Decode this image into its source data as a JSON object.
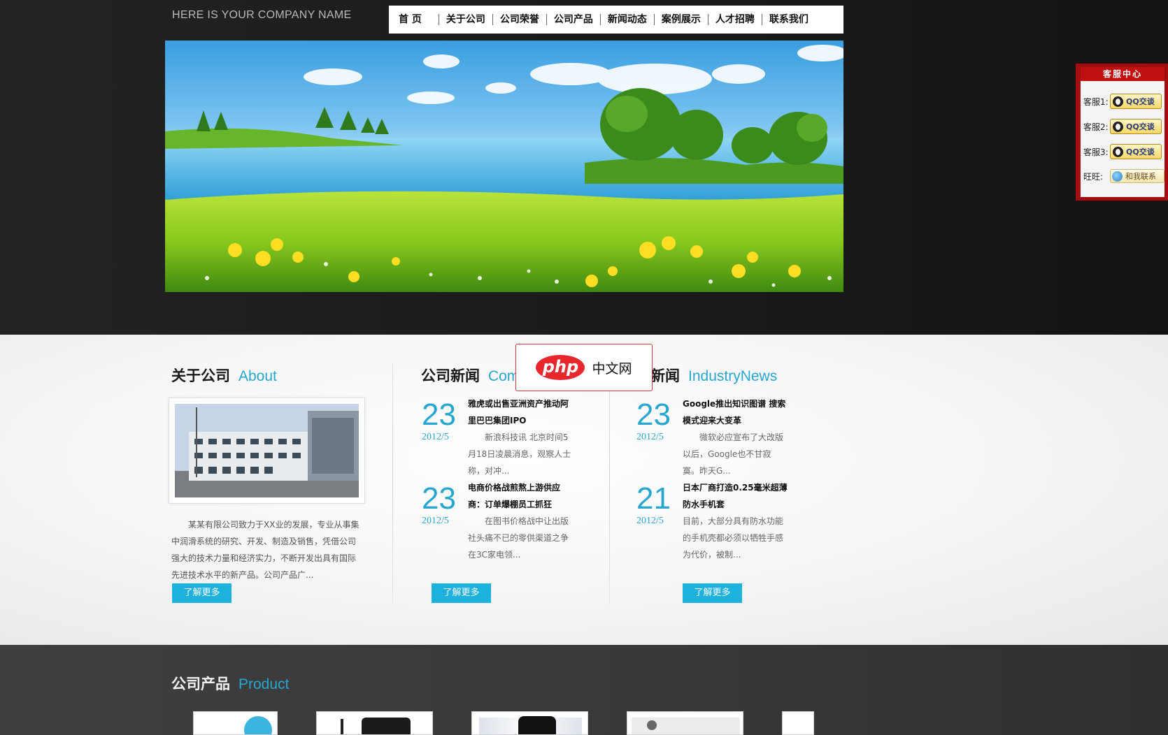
{
  "header": {
    "company_name": "HERE IS YOUR COMPANY NAME",
    "nav": [
      {
        "label": "首 页"
      },
      {
        "label": "关于公司"
      },
      {
        "label": "公司荣誉"
      },
      {
        "label": "公司产品"
      },
      {
        "label": "新闻动态"
      },
      {
        "label": "案例展示"
      },
      {
        "label": "人才招聘"
      },
      {
        "label": "联系我们"
      }
    ]
  },
  "service": {
    "title": "客服中心",
    "rows": [
      {
        "label": "客服1:",
        "button": "QQ交谈"
      },
      {
        "label": "客服2:",
        "button": "QQ交谈"
      },
      {
        "label": "客服3:",
        "button": "QQ交谈"
      },
      {
        "label": "旺旺:",
        "button": "和我联系"
      }
    ]
  },
  "about": {
    "title_cn": "关于公司",
    "title_en": "About",
    "text": "某某有限公司致力于XX业的发展，专业从事集中润滑系统的研究、开发、制造及销售，凭借公司强大的技术力量和经济实力，不断开发出具有国际先进技术水平的新产品。公司产品广...",
    "more": "了解更多"
  },
  "company_news": {
    "title_cn": "公司新闻",
    "title_en": "CompanyNews",
    "items": [
      {
        "day": "23",
        "month": "2012/5",
        "title": "雅虎或出售亚洲资产推动阿里巴巴集团IPO",
        "desc": "新浪科技讯 北京时间5月18日凌晨消息，观察人士称，对冲..."
      },
      {
        "day": "23",
        "month": "2012/5",
        "title": "电商价格战煎熬上游供应商：订单爆棚员工抓狂",
        "desc": "在图书价格战中让出版社头痛不已的零供渠道之争在3C家电领..."
      }
    ],
    "more": "了解更多"
  },
  "industry_news": {
    "title_cn": "行业新闻",
    "title_en": "IndustryNews",
    "items": [
      {
        "day": "23",
        "month": "2012/5",
        "title": "Google推出知识图谱 搜索模式迎来大变革",
        "desc": "微软必应宣布了大改版以后，Google也不甘寂寞。昨天G..."
      },
      {
        "day": "21",
        "month": "2012/5",
        "title": "日本厂商打造0.25毫米超薄防水手机套",
        "desc": "目前，大部分具有防水功能的手机壳都必须以牺牲手感为代价，被制..."
      }
    ],
    "more": "了解更多"
  },
  "overlay": {
    "logo_text": "php",
    "logo_cn": "中文网"
  },
  "products": {
    "title_cn": "公司产品",
    "title_en": "Product"
  }
}
